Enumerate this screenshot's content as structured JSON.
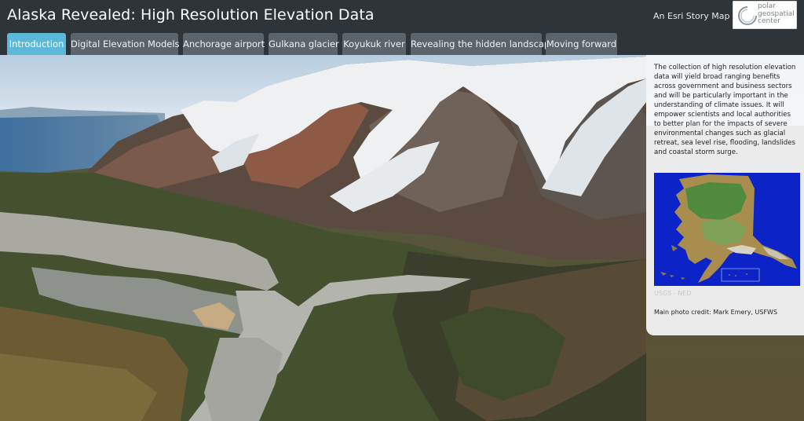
{
  "header": {
    "title": "Alaska Revealed: High Resolution Elevation Data",
    "esri_label": "An Esri Story Map",
    "logo": {
      "lines": [
        "polar",
        "geospatial",
        "center"
      ]
    }
  },
  "tabs": [
    {
      "label": "Introduction",
      "active": true
    },
    {
      "label": "Digital Elevation Models",
      "active": false
    },
    {
      "label": "Anchorage airport",
      "active": false
    },
    {
      "label": "Gulkana glacier",
      "active": false
    },
    {
      "label": "Koyukuk river",
      "active": false
    },
    {
      "label": "Revealing the hidden landscape",
      "active": false
    },
    {
      "label": "Moving forward",
      "active": false
    }
  ],
  "panel": {
    "text": "The collection of high resolution elevation data will yield broad ranging benefits across government and business sectors and will be particularly important in the understanding of climate issues. It will empower scientists and local authorities to better plan for the impacts of severe environmental changes such as glacial retreat, sea level rise, flooding, landslides and coastal storm surge.",
    "map_caption": "USGS - NED",
    "photo_credit": "Main photo credit: Mark Emery, USFWS"
  },
  "colors": {
    "header_bg": "#2f3438",
    "tab_bg": "#5b646b",
    "tab_active_bg": "#5bb8d9",
    "map_ocean": "#0b23c7"
  }
}
